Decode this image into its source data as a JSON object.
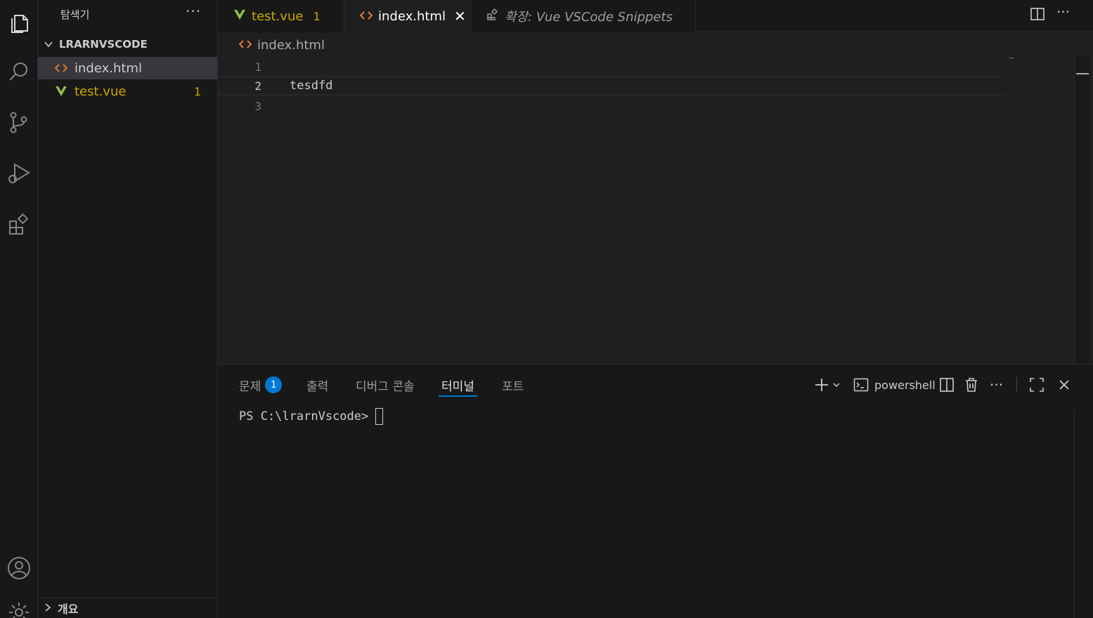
{
  "sidebar": {
    "title": "탐색기",
    "folder": "LRARNVSCODE",
    "files": [
      {
        "name": "index.html",
        "icon": "html-icon",
        "selected": true
      },
      {
        "name": "test.vue",
        "icon": "vue-icon",
        "problems": "1"
      }
    ],
    "outline_label": "개요"
  },
  "tabs": [
    {
      "label": "test.vue",
      "count": "1",
      "icon": "vue-icon"
    },
    {
      "label": "index.html",
      "icon": "html-icon",
      "active": true
    },
    {
      "label": "확장: Vue VSCode Snippets",
      "icon": "extensions-icon"
    }
  ],
  "breadcrumb": {
    "file": "index.html"
  },
  "editor": {
    "lines": [
      {
        "number": "1",
        "text": ""
      },
      {
        "number": "2",
        "text": "tesdfd"
      },
      {
        "number": "3",
        "text": ""
      }
    ]
  },
  "panel": {
    "tabs": [
      {
        "label": "문제",
        "badge": "1"
      },
      {
        "label": "출력"
      },
      {
        "label": "디버그 콘솔"
      },
      {
        "label": "터미널",
        "active": true
      },
      {
        "label": "포트"
      }
    ],
    "shell_name": "powershell",
    "terminal_prompt": "PS C:\\lrarnVscode>"
  },
  "colors": {
    "accent": "#0078d4",
    "warning": "#cca700",
    "html_icon": "#e37933",
    "vue_icon": "#8dc149"
  }
}
